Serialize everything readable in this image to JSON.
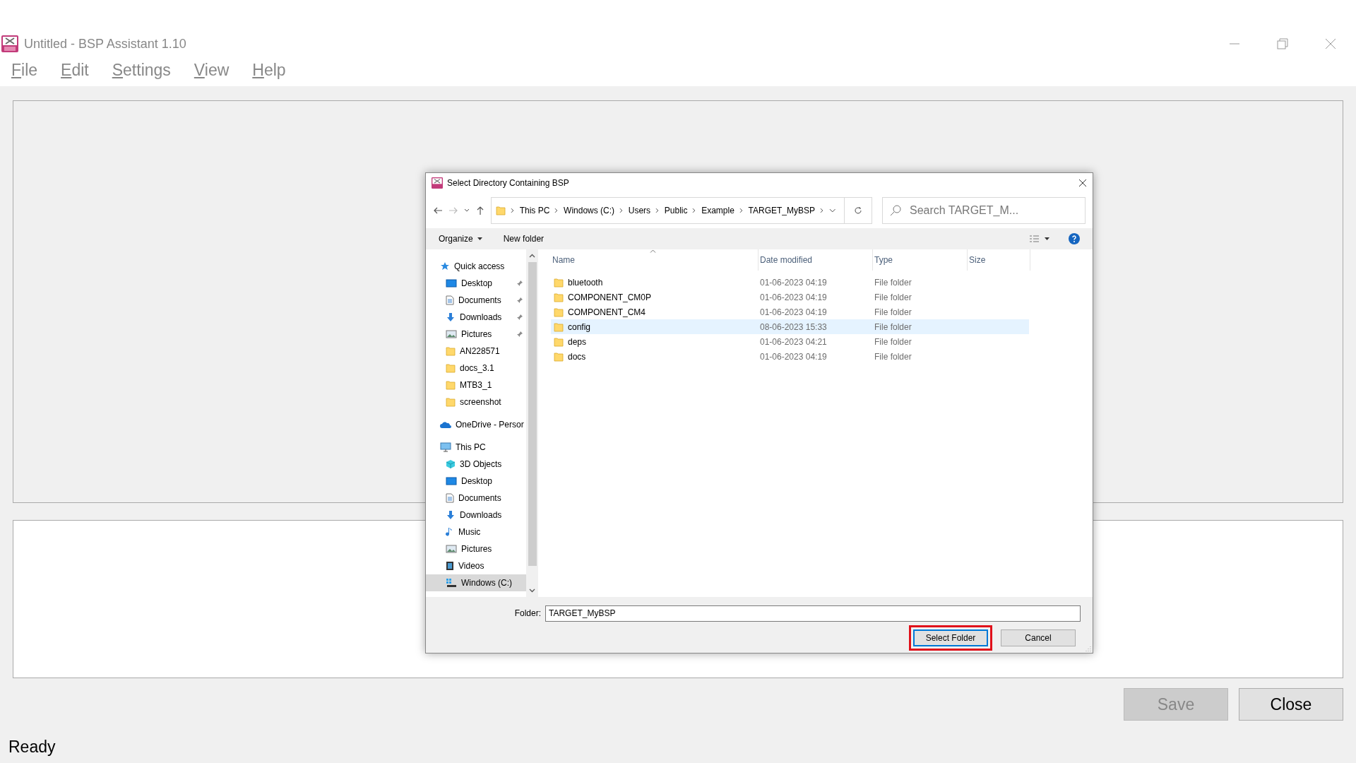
{
  "window": {
    "title": "Untitled - BSP Assistant 1.10"
  },
  "menu": [
    "File",
    "Edit",
    "Settings",
    "View",
    "Help"
  ],
  "dialog": {
    "title": "Select Directory Containing BSP",
    "breadcrumb": [
      "This PC",
      "Windows (C:)",
      "Users",
      "Public",
      "Example",
      "TARGET_MyBSP"
    ],
    "search": {
      "placeholder": "Search TARGET_M..."
    },
    "toolbar": {
      "organize": "Organize",
      "new_folder": "New folder"
    },
    "nav": [
      {
        "label": "Quick access",
        "kind": "star",
        "selected": false,
        "children": [
          {
            "label": "Desktop",
            "kind": "desktop",
            "pinned": true,
            "selected": false
          },
          {
            "label": "Documents",
            "kind": "documents",
            "pinned": true,
            "selected": false
          },
          {
            "label": "Downloads",
            "kind": "downloads",
            "pinned": true,
            "selected": false
          },
          {
            "label": "Pictures",
            "kind": "pictures",
            "pinned": true,
            "selected": false
          },
          {
            "label": "AN228571",
            "kind": "folder",
            "pinned": false,
            "selected": false
          },
          {
            "label": "docs_3.1",
            "kind": "folder",
            "pinned": false,
            "selected": false
          },
          {
            "label": "MTB3_1",
            "kind": "folder",
            "pinned": false,
            "selected": false
          },
          {
            "label": "screenshot",
            "kind": "folder",
            "pinned": false,
            "selected": false
          }
        ]
      },
      {
        "label": "OneDrive - Persor",
        "kind": "cloud",
        "selected": false
      },
      {
        "label": "This PC",
        "kind": "pc",
        "selected": false,
        "children": [
          {
            "label": "3D Objects",
            "kind": "cube",
            "pinned": false,
            "selected": false
          },
          {
            "label": "Desktop",
            "kind": "desktop",
            "pinned": false,
            "selected": false
          },
          {
            "label": "Documents",
            "kind": "documents",
            "pinned": false,
            "selected": false
          },
          {
            "label": "Downloads",
            "kind": "downloads",
            "pinned": false,
            "selected": false
          },
          {
            "label": "Music",
            "kind": "music",
            "pinned": false,
            "selected": false
          },
          {
            "label": "Pictures",
            "kind": "pictures",
            "pinned": false,
            "selected": false
          },
          {
            "label": "Videos",
            "kind": "videos",
            "pinned": false,
            "selected": false
          },
          {
            "label": "Windows (C:)",
            "kind": "drive",
            "pinned": false,
            "selected": true
          }
        ]
      }
    ],
    "columns": [
      "Name",
      "Date modified",
      "Type",
      "Size"
    ],
    "rows": [
      {
        "name": "bluetooth",
        "date": "01-06-2023 04:19",
        "type": "File folder",
        "selected": false
      },
      {
        "name": "COMPONENT_CM0P",
        "date": "01-06-2023 04:19",
        "type": "File folder",
        "selected": false
      },
      {
        "name": "COMPONENT_CM4",
        "date": "01-06-2023 04:19",
        "type": "File folder",
        "selected": false
      },
      {
        "name": "config",
        "date": "08-06-2023 15:33",
        "type": "File folder",
        "selected": true
      },
      {
        "name": "deps",
        "date": "01-06-2023 04:21",
        "type": "File folder",
        "selected": false
      },
      {
        "name": "docs",
        "date": "01-06-2023 04:19",
        "type": "File folder",
        "selected": false
      }
    ],
    "folder": {
      "label": "Folder:",
      "value": "TARGET_MyBSP"
    },
    "buttons": [
      {
        "label": "Select Folder",
        "default": true,
        "highlighted": true
      },
      {
        "label": "Cancel",
        "default": false,
        "highlighted": false
      }
    ]
  },
  "buttons": [
    {
      "label": "Save",
      "disabled": true
    },
    {
      "label": "Close",
      "disabled": false
    }
  ],
  "status_bar": "Ready"
}
